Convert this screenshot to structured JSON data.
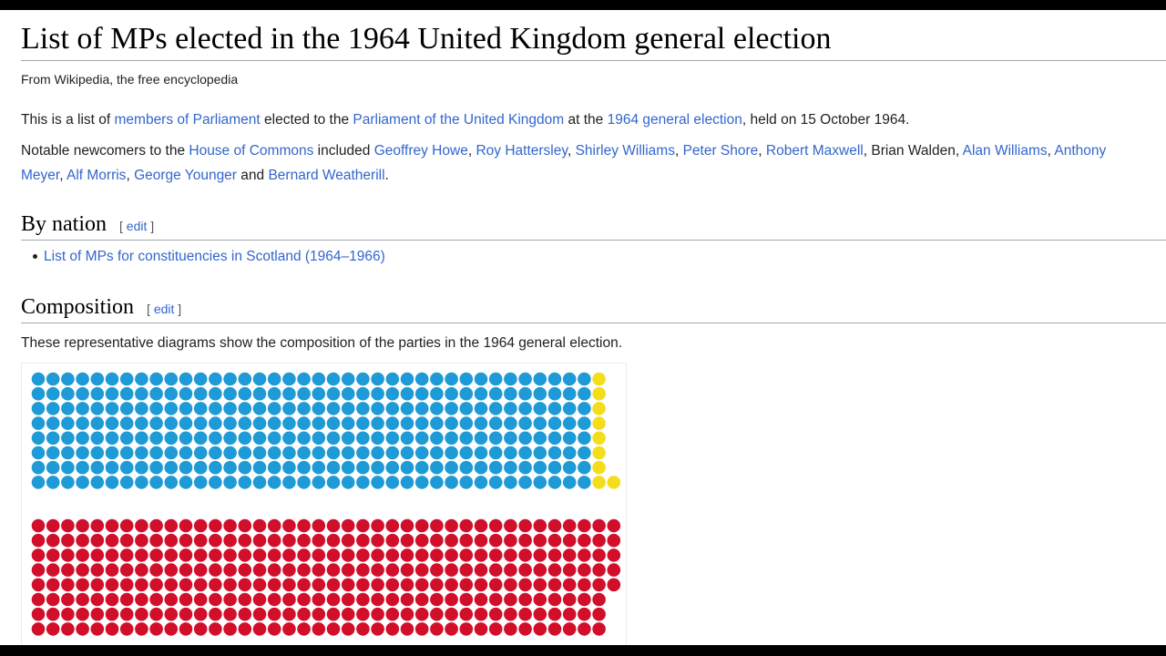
{
  "page": {
    "title": "List of MPs elected in the 1964 United Kingdom general election",
    "tagline": "From Wikipedia, the free encyclopedia"
  },
  "intro": {
    "t1": "This is a list of ",
    "l1": "members of Parliament",
    "t2": " elected to the ",
    "l2": "Parliament of the United Kingdom",
    "t3": " at the ",
    "l3": "1964 general election",
    "t4": ", held on 15 October 1964."
  },
  "notable": {
    "prefix": "Notable newcomers to the ",
    "house_link": "House of Commons",
    "included": " included ",
    "names": [
      "Geoffrey Howe",
      "Roy Hattersley",
      "Shirley Williams",
      "Peter Shore",
      "Robert Maxwell",
      "Brian Walden",
      "Alan Williams",
      "Anthony Meyer",
      "Alf Morris",
      "George Younger"
    ],
    "and": " and ",
    "last": "Bernard Weatherill",
    "end": "."
  },
  "sections": {
    "by_nation": {
      "heading": "By nation",
      "edit_open": "[ ",
      "edit": "edit",
      "edit_close": " ]",
      "items": [
        "List of MPs for constituencies in Scotland (1964–1966)"
      ]
    },
    "composition": {
      "heading": "Composition",
      "edit_open": "[ ",
      "edit": "edit",
      "edit_close": " ]",
      "text": "These representative diagrams show the composition of the parties in the 1964 general election."
    }
  },
  "colors": {
    "conservative": "#1e9ad6",
    "liberal": "#f4de1c",
    "labour": "#d10f2a",
    "link": "#3366cc"
  },
  "diagram_data": {
    "top_block": {
      "blue_columns": 38,
      "yellow_columns": 1,
      "rows": 8,
      "extra_yellow": 1
    },
    "bottom_block": {
      "full_columns": 39,
      "rows": 8,
      "partial_last_column_rows": 5,
      "partial_visible_height_rows": 8
    }
  }
}
